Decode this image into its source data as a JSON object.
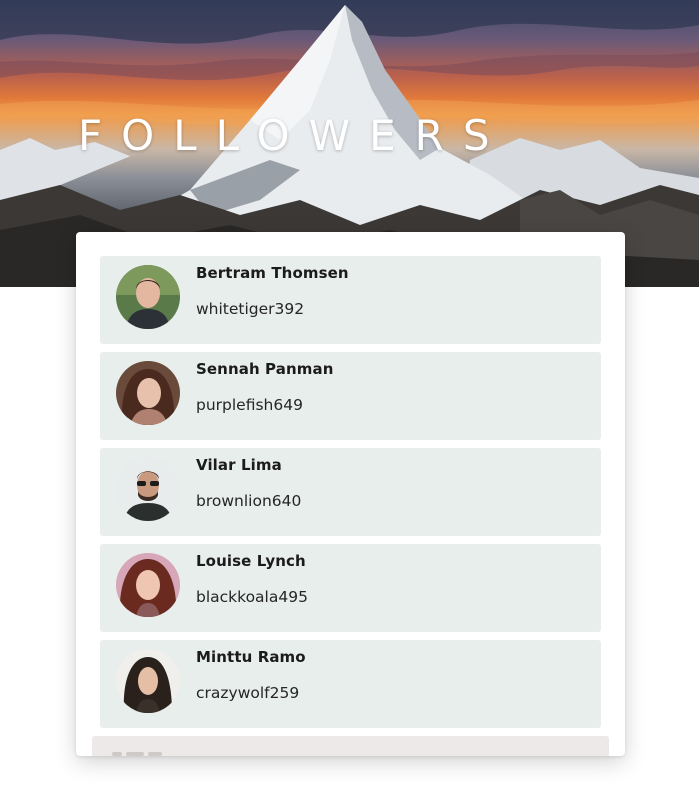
{
  "header": {
    "title": "FOLLOWERS",
    "background": "mountain-sunset-image"
  },
  "followers": [
    {
      "name": "Bertram Thomsen",
      "username": "whitetiger392",
      "avatar": "avatar-photo"
    },
    {
      "name": "Sennah Panman",
      "username": "purplefish649",
      "avatar": "avatar-photo"
    },
    {
      "name": "Vilar Lima",
      "username": "brownlion640",
      "avatar": "avatar-photo"
    },
    {
      "name": "Louise Lynch",
      "username": "blackkoala495",
      "avatar": "avatar-photo"
    },
    {
      "name": "Minttu Ramo",
      "username": "crazywolf259",
      "avatar": "avatar-photo"
    }
  ],
  "colors": {
    "row_background": "#e8eeec",
    "footer_background": "#ece9e8",
    "title": "#ffffff"
  }
}
